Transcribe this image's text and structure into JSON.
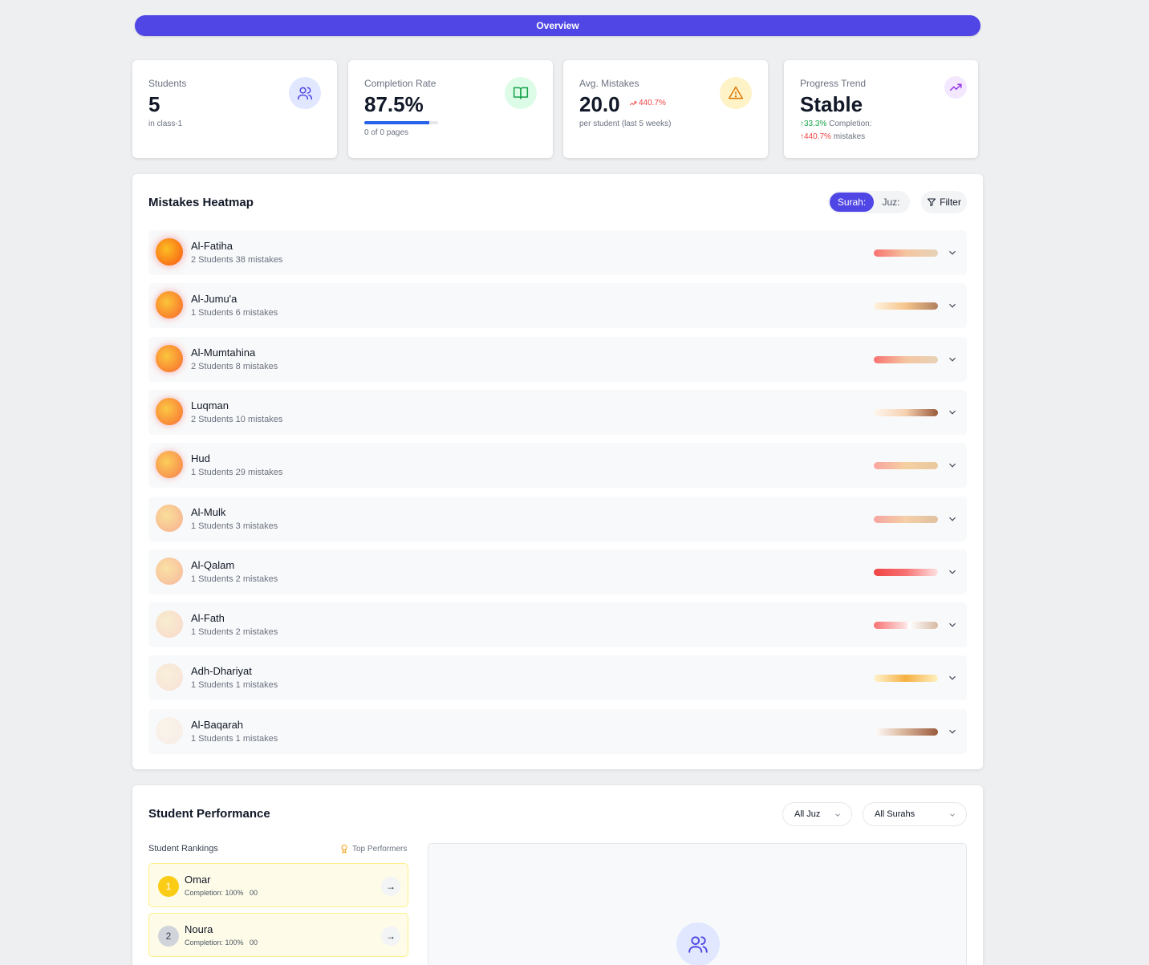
{
  "header": {
    "title": "Overview",
    "accent": "#4f46e5"
  },
  "stats": {
    "students": {
      "label": "Students",
      "value": "5",
      "sub": "in class-1",
      "icon": "users-icon"
    },
    "completion": {
      "label": "Completion Rate",
      "value": "87.5%",
      "progress": 0.875,
      "sub": "0 of 0 pages",
      "icon": "book-open-icon"
    },
    "mistakes": {
      "label": "Avg. Mistakes",
      "value": "20.0",
      "delta": "440.7%",
      "sub": "per student (last 5 weeks)",
      "icon": "alert-triangle-icon"
    },
    "trend": {
      "label": "Progress Trend",
      "value": "Stable",
      "completion_delta": "33.3%",
      "completion_label": "Completion:",
      "mistakes_delta": "440.7%",
      "mistakes_label": "mistakes",
      "icon": "trending-up-icon"
    }
  },
  "heatmap": {
    "title": "Mistakes Heatmap",
    "toggle": {
      "active": "Surah:",
      "inactive": "Juz:"
    },
    "filter_label": "Filter",
    "rows": [
      {
        "name": "Al-Fatiha",
        "meta": "2 Students 38 mistakes",
        "intensity": 1.0
      },
      {
        "name": "Al-Jumu'a",
        "meta": "1 Students 6 mistakes",
        "intensity": 0.9
      },
      {
        "name": "Al-Mumtahina",
        "meta": "2 Students 8 mistakes",
        "intensity": 0.88
      },
      {
        "name": "Luqman",
        "meta": "2 Students 10 mistakes",
        "intensity": 0.85
      },
      {
        "name": "Hud",
        "meta": "1 Students 29 mistakes",
        "intensity": 0.75
      },
      {
        "name": "Al-Mulk",
        "meta": "1 Students 3 mistakes",
        "intensity": 0.45
      },
      {
        "name": "Al-Qalam",
        "meta": "1 Students 2 mistakes",
        "intensity": 0.4
      },
      {
        "name": "Al-Fath",
        "meta": "1 Students 2 mistakes",
        "intensity": 0.2
      },
      {
        "name": "Adh-Dhariyat",
        "meta": "1 Students 1 mistakes",
        "intensity": 0.15
      },
      {
        "name": "Al-Baqarah",
        "meta": "1 Students 1 mistakes",
        "intensity": 0.05
      }
    ]
  },
  "performance": {
    "title": "Student Performance",
    "juz_select": "All Juz",
    "surah_select": "All Surahs",
    "rankings_label": "Student Rankings",
    "top_performers_label": "Top Performers",
    "students": [
      {
        "rank": "1",
        "name": "Omar",
        "meta": "Completion: 100%   00"
      },
      {
        "rank": "2",
        "name": "Noura",
        "meta": "Completion: 100%   00"
      }
    ]
  }
}
